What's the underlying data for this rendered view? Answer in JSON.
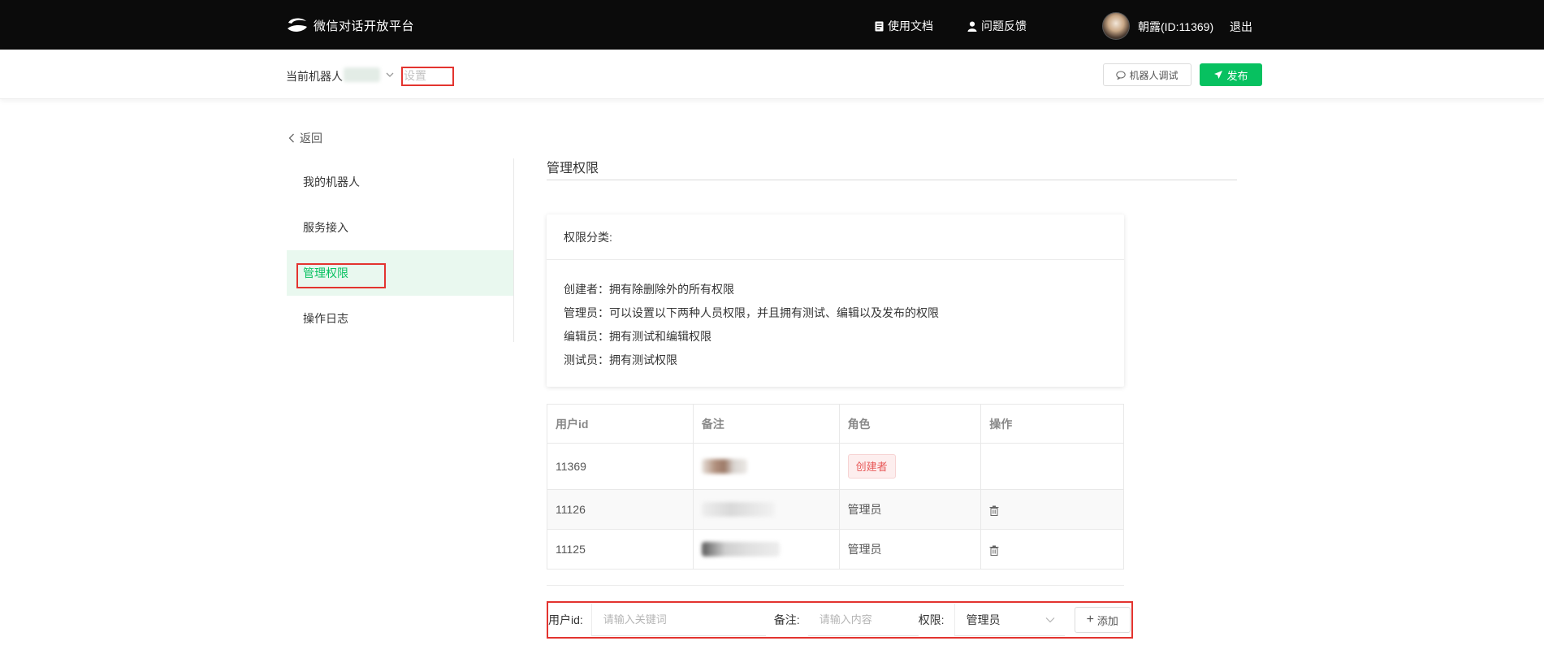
{
  "header": {
    "logo_text": "微信对话开放平台",
    "docs_label": "使用文档",
    "feedback_label": "问题反馈",
    "user_name": "朝露(ID:11369)",
    "logout_label": "退出"
  },
  "subheader": {
    "current_bot_label": "当前机器人",
    "settings_label": "设置",
    "debug_button": "机器人调试",
    "publish_button": "发布"
  },
  "sidebar": {
    "back_label": "返回",
    "items": [
      {
        "label": "我的机器人",
        "active": false
      },
      {
        "label": "服务接入",
        "active": false
      },
      {
        "label": "管理权限",
        "active": true
      },
      {
        "label": "操作日志",
        "active": false
      }
    ]
  },
  "main": {
    "title": "管理权限",
    "permission_card": {
      "heading": "权限分类:",
      "lines": [
        "创建者：拥有除删除外的所有权限",
        "管理员：可以设置以下两种人员权限，并且拥有测试、编辑以及发布的权限",
        "编辑员：拥有测试和编辑权限",
        "测试员：拥有测试权限"
      ]
    },
    "table": {
      "headers": [
        "用户id",
        "备注",
        "角色",
        "操作"
      ],
      "rows": [
        {
          "user_id": "11369",
          "role": "创建者",
          "deletable": false
        },
        {
          "user_id": "11126",
          "role": "管理员",
          "deletable": true
        },
        {
          "user_id": "11125",
          "role": "管理员",
          "deletable": true
        }
      ]
    },
    "add_form": {
      "user_id_label": "用户id:",
      "user_id_placeholder": "请输入关键词",
      "note_label": "备注:",
      "note_placeholder": "请输入内容",
      "role_label": "权限:",
      "role_value": "管理员",
      "add_button": "添加"
    }
  },
  "colors": {
    "accent_green": "#07c160",
    "creator_tag": "#e85a5a",
    "topbar": "#0b0b0b",
    "highlight_box": "#e3342f"
  }
}
